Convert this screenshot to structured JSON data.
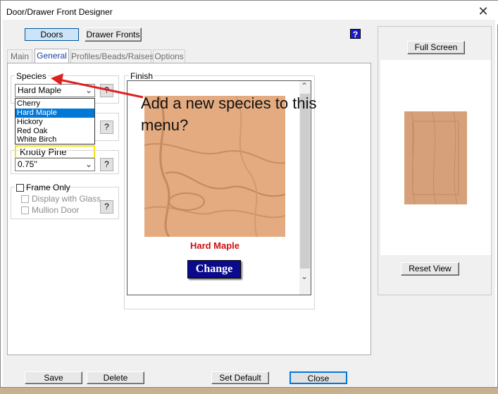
{
  "window": {
    "title": "Door/Drawer Front Designer",
    "close_glyph": "✕"
  },
  "top_buttons": {
    "doors": "Doors",
    "drawer_fronts": "Drawer Fronts",
    "help": "?"
  },
  "tabs": [
    {
      "label": "Main",
      "active": false
    },
    {
      "label": "General",
      "active": true
    },
    {
      "label": "Profiles/Beads/Raises",
      "active": false
    },
    {
      "label": "Options",
      "active": false
    }
  ],
  "species": {
    "legend": "Species",
    "selected": "Hard Maple",
    "options": [
      "Cherry",
      "Hard Maple",
      "Hickory",
      "Red Oak",
      "White Birch"
    ],
    "highlighted_index": 1,
    "help": "?"
  },
  "proposed_item": "Knotty Pine",
  "thickness": {
    "value": "0.75''",
    "help": "?"
  },
  "extra_help": "?",
  "frame_only": {
    "label": "Frame Only",
    "checked": false
  },
  "display_with_glass": {
    "label": "Display with Glass",
    "checked": false
  },
  "mullion_door": {
    "label": "Mullion Door",
    "checked": false
  },
  "mullion_help": "?",
  "finish": {
    "legend": "Finish",
    "name": "Hard Maple",
    "change_button": "Change",
    "name_color": "#cc1111"
  },
  "annotation": {
    "line1": "Add a new species to this",
    "line2": "menu?"
  },
  "preview": {
    "full_screen": "Full Screen",
    "reset_view": "Reset View"
  },
  "bottom_buttons": {
    "save": "Save",
    "delete": "Delete",
    "set_default": "Set Default",
    "close": "Close"
  },
  "icons": {
    "annotation_arrow": "arrow-left-icon",
    "scroll_up": "chevron-up-icon",
    "scroll_down": "chevron-down-icon",
    "combo_arrow": "chevron-down-icon"
  },
  "colors": {
    "accent_blue": "#0078d7",
    "highlight_box": "#f5e600",
    "annotation_arrow": "#e02020",
    "change_button": "#0a0a8c"
  }
}
